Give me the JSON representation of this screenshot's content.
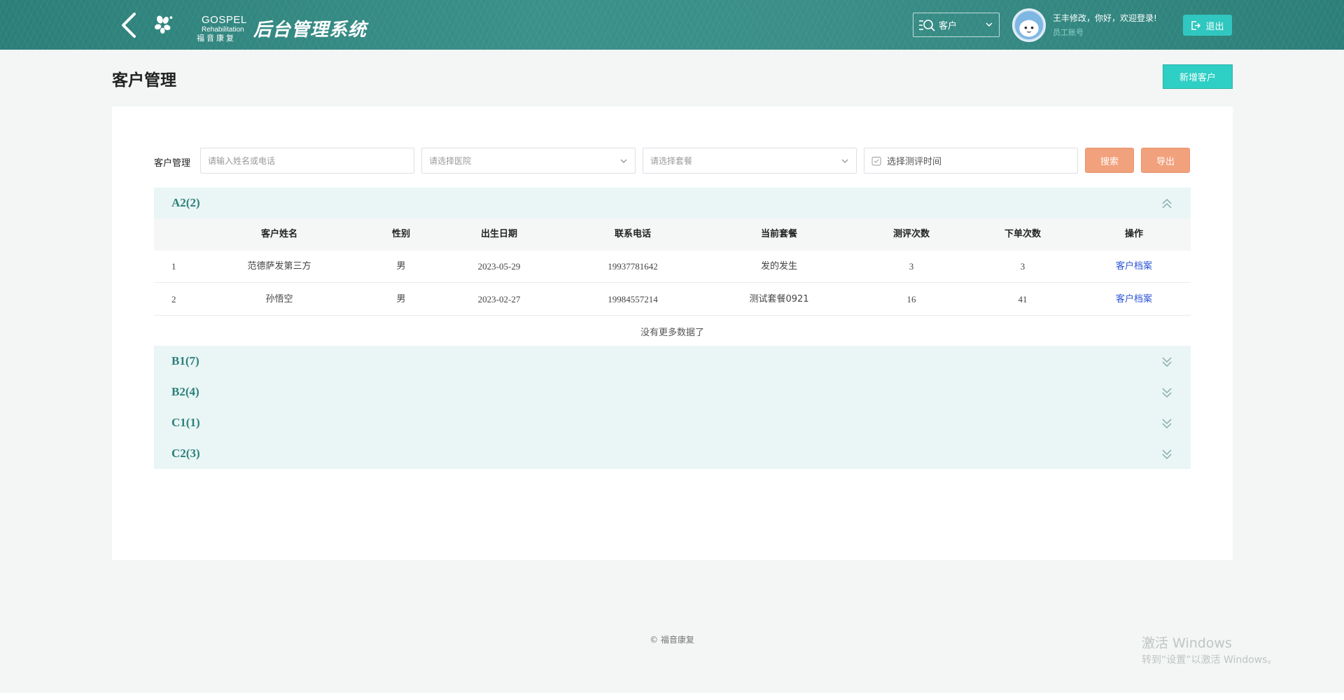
{
  "header": {
    "logo_en_top": "GOSPEL",
    "logo_en_bottom": "Rehabilitation",
    "logo_cn": "福音康复",
    "system_title": "后台管理系统",
    "search_type": "客户",
    "user_greeting": "王丰修改，你好，欢迎登录!",
    "user_role": "员工账号",
    "logout_label": "退出"
  },
  "page": {
    "title": "客户管理",
    "add_button": "新增客户"
  },
  "filters": {
    "label": "客户管理",
    "name_placeholder": "请输入姓名或电话",
    "hospital_placeholder": "请选择医院",
    "package_placeholder": "请选择套餐",
    "date_placeholder": "选择测评时间",
    "search_button": "搜索",
    "export_button": "导出"
  },
  "groups": [
    {
      "name": "A2(2)",
      "expanded": true
    },
    {
      "name": "B1(7)",
      "expanded": false
    },
    {
      "name": "B2(4)",
      "expanded": false
    },
    {
      "name": "C1(1)",
      "expanded": false
    },
    {
      "name": "C2(3)",
      "expanded": false
    }
  ],
  "table": {
    "columns": [
      "客户姓名",
      "性别",
      "出生日期",
      "联系电话",
      "当前套餐",
      "测评次数",
      "下单次数",
      "操作"
    ],
    "rows": [
      {
        "index": "1",
        "name": "范德萨发第三方",
        "gender": "男",
        "birth": "2023-05-29",
        "phone": "19937781642",
        "package": "发的发生",
        "evaluations": "3",
        "orders": "3",
        "action": "客户档案"
      },
      {
        "index": "2",
        "name": "孙悟空",
        "gender": "男",
        "birth": "2023-02-27",
        "phone": "19984557214",
        "package": "测试套餐0921",
        "evaluations": "16",
        "orders": "41",
        "action": "客户档案"
      }
    ],
    "no_more": "没有更多数据了"
  },
  "footer": {
    "copyright": "© 福音康复"
  },
  "watermark": {
    "title": "激活 Windows",
    "subtitle": "转到“设置”以激活 Windows。"
  },
  "colors": {
    "header_bg": "#2c7f79",
    "accent": "#2ecfc4",
    "orange_button": "#f2a17d",
    "group_bg": "#e9f6f5",
    "link": "#2a53d6"
  }
}
